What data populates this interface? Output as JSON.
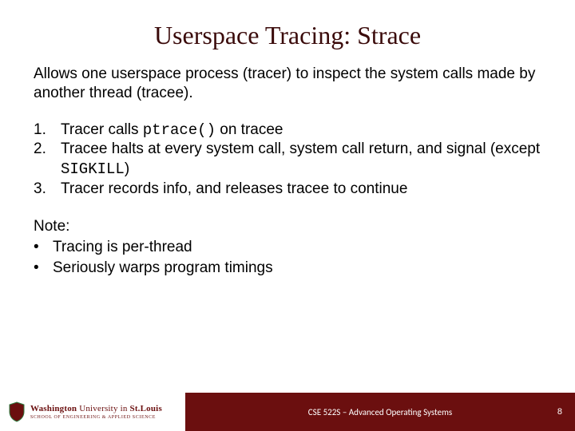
{
  "title": "Userspace Tracing: Strace",
  "lead": "Allows one userspace process (tracer) to inspect the system calls made by another thread (tracee).",
  "steps": [
    {
      "num": "1.",
      "pre": "Tracer calls ",
      "code": "ptrace()",
      "post": " on tracee"
    },
    {
      "num": "2.",
      "pre": "Tracee halts at every system call, system call return, and signal (except ",
      "code": "SIGKILL",
      "post": ")"
    },
    {
      "num": "3.",
      "pre": "Tracer records info, and releases tracee to continue",
      "code": "",
      "post": ""
    }
  ],
  "note": {
    "label": "Note:",
    "bullets": [
      "Tracing is per-thread",
      "Seriously warps program timings"
    ]
  },
  "footer": {
    "wordmark_top_a": "Washington",
    "wordmark_top_b": " University in ",
    "wordmark_top_c": "St.Louis",
    "wordmark_bottom": "SCHOOL OF ENGINEERING & APPLIED SCIENCE",
    "course": "CSE 522S – Advanced Operating Systems",
    "page": "8"
  }
}
